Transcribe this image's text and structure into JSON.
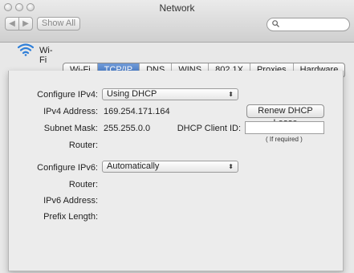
{
  "window": {
    "title": "Network"
  },
  "toolbar": {
    "show_all": "Show All",
    "back_icon": "chevron-left-icon",
    "forward_icon": "chevron-right-icon",
    "search_icon": "search-icon"
  },
  "interface": {
    "name": "Wi-Fi",
    "icon": "wifi-icon"
  },
  "tabs": [
    {
      "label": "Wi-Fi",
      "active": false
    },
    {
      "label": "TCP/IP",
      "active": true
    },
    {
      "label": "DNS",
      "active": false
    },
    {
      "label": "WINS",
      "active": false
    },
    {
      "label": "802.1X",
      "active": false
    },
    {
      "label": "Proxies",
      "active": false
    },
    {
      "label": "Hardware",
      "active": false
    }
  ],
  "ipv4": {
    "configure_label": "Configure IPv4:",
    "configure_value": "Using DHCP",
    "address_label": "IPv4 Address:",
    "address_value": "169.254.171.164",
    "renew_button": "Renew DHCP Lease",
    "subnet_label": "Subnet Mask:",
    "subnet_value": "255.255.0.0",
    "client_id_label": "DHCP Client ID:",
    "client_id_value": "",
    "client_id_hint": "( If required )",
    "router_label": "Router:"
  },
  "ipv6": {
    "configure_label": "Configure IPv6:",
    "configure_value": "Automatically",
    "router_label": "Router:",
    "address_label": "IPv6 Address:",
    "prefix_label": "Prefix Length:"
  },
  "colors": {
    "accent": "#3d72c4",
    "window_bg": "#e8e8e8"
  }
}
